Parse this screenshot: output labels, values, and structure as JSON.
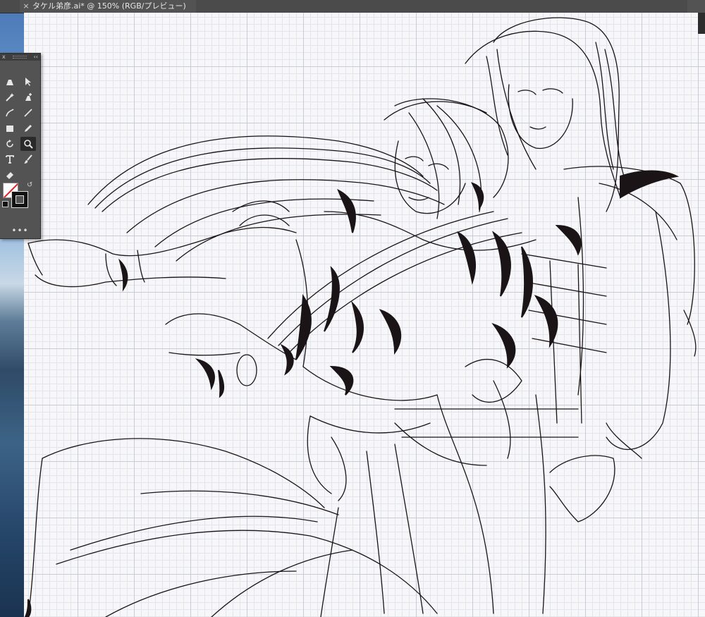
{
  "document_tab": {
    "close_glyph": "×",
    "title": "タケル弟彦.ai* @ 150% (RGB/プレビュー)"
  },
  "tools_panel": {
    "collapse_glyph": "x",
    "expand_glyph": "‹‹",
    "more_glyph": "•••",
    "active_tool": "zoom-tool",
    "fill": "none",
    "stroke": "#000000"
  },
  "canvas": {
    "background": "#f7f7f9",
    "grid_color": "#c9cbd6",
    "ink_color": "#1a1416"
  }
}
